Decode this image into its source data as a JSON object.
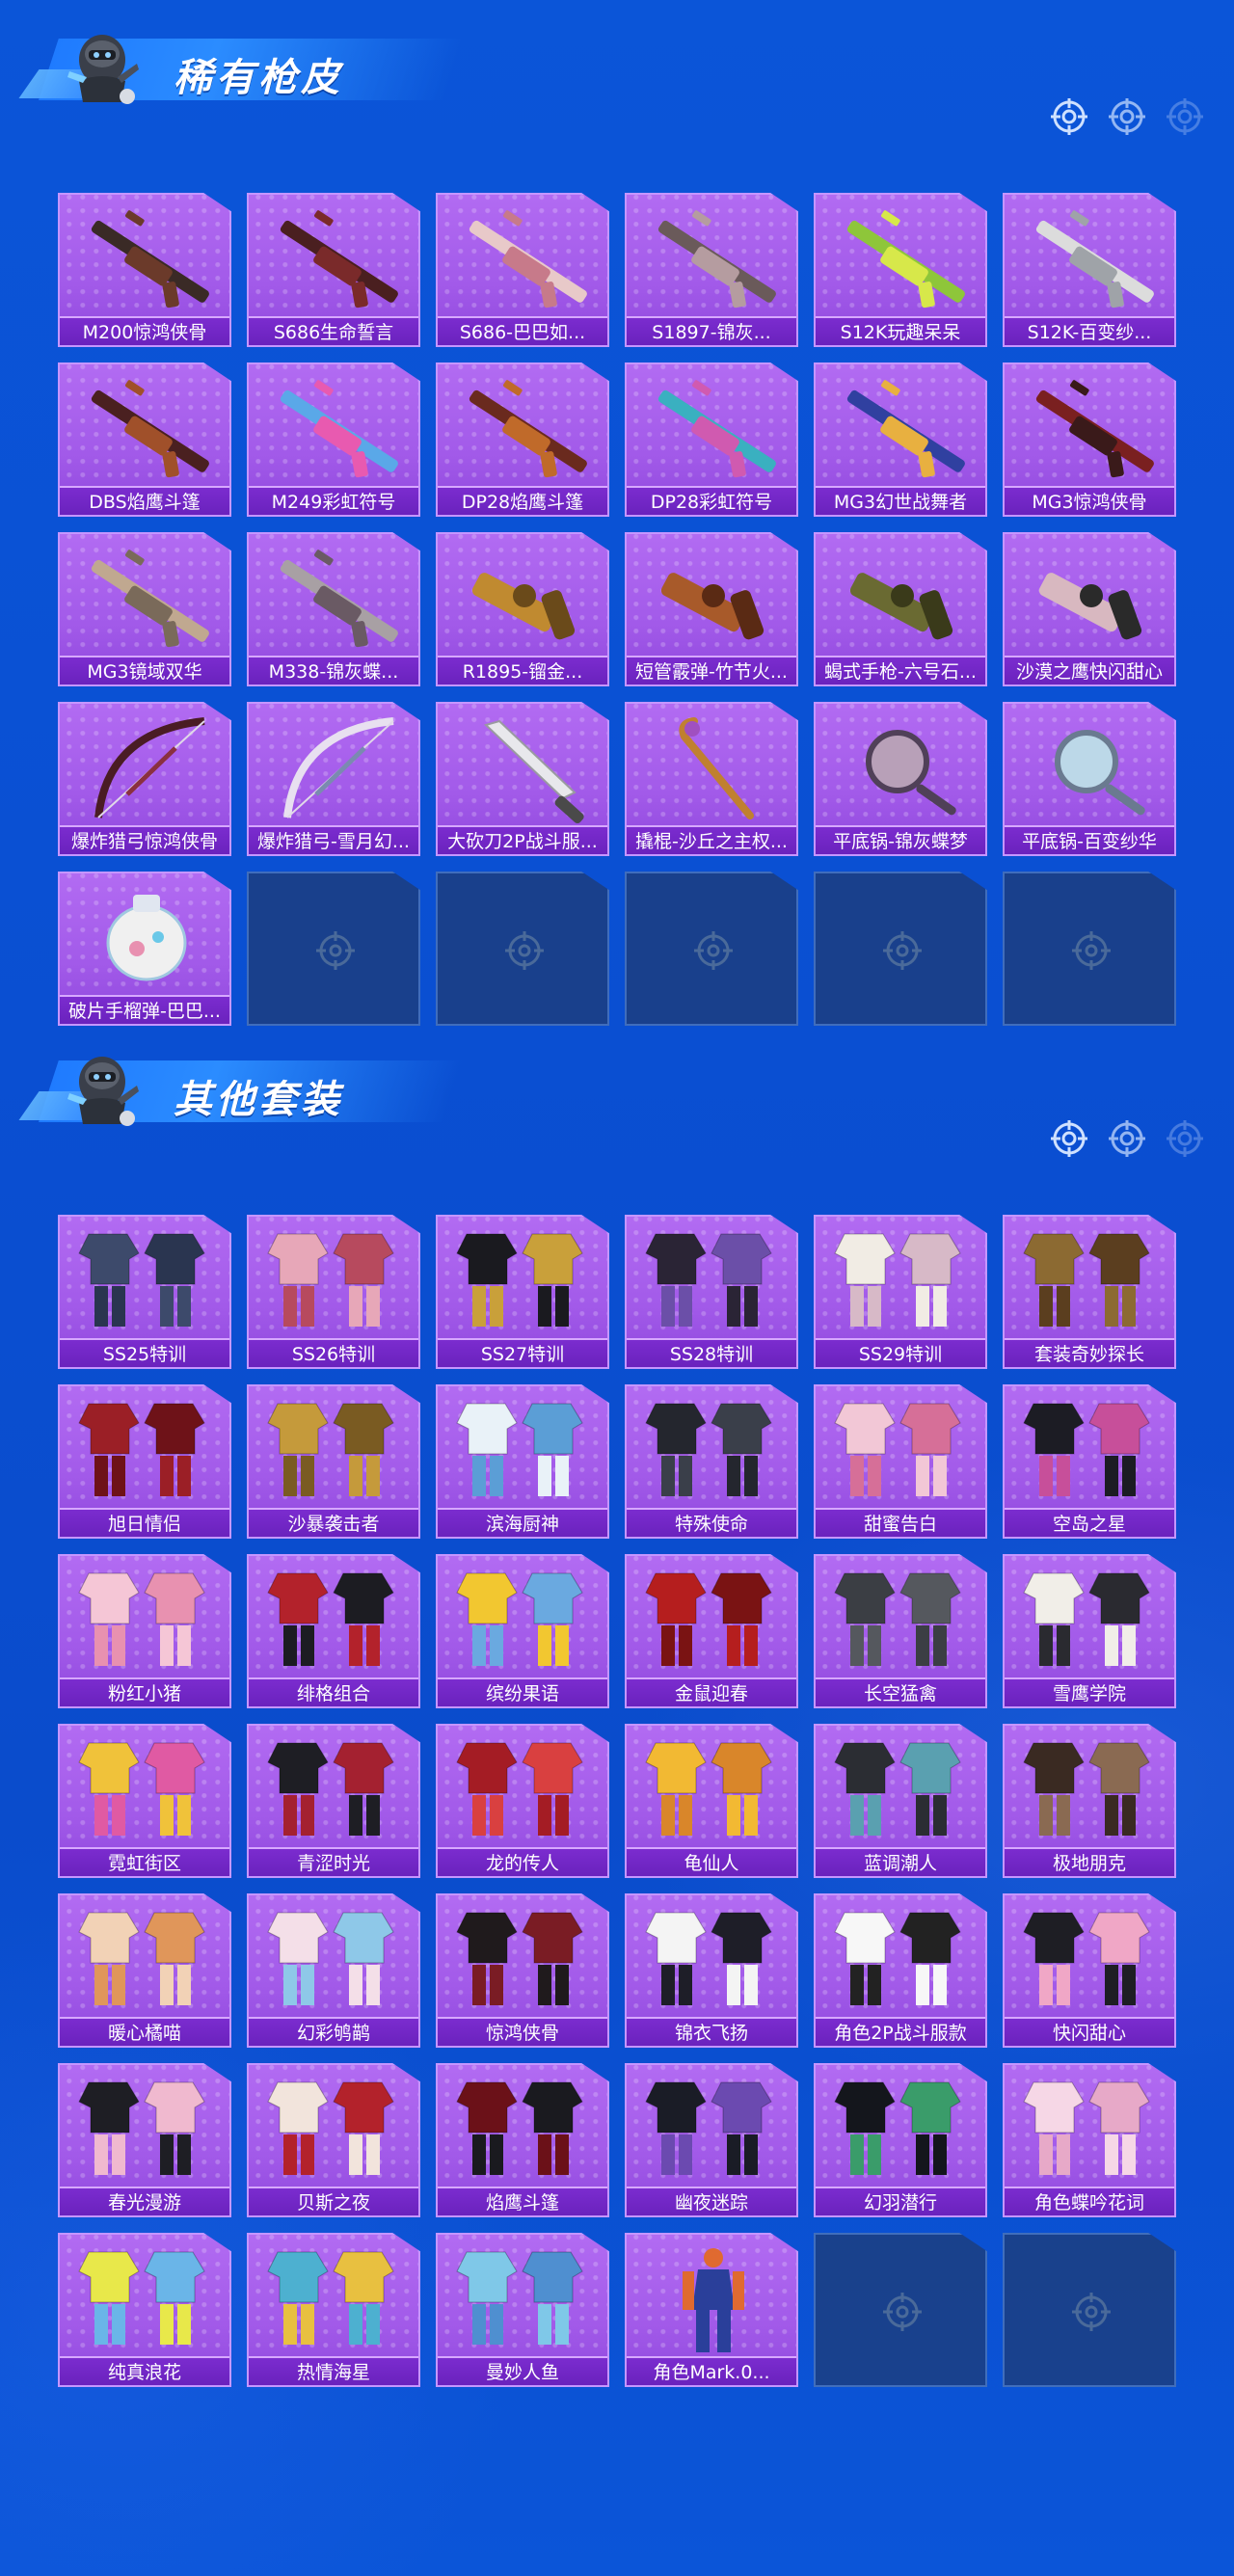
{
  "sections": [
    {
      "title": "稀有枪皮",
      "icon": "mascot-icon",
      "items": [
        {
          "label": "M200惊鸿侠骨",
          "icon": "sniper-rifle-icon"
        },
        {
          "label": "S686生命誓言",
          "icon": "shotgun-icon"
        },
        {
          "label": "S686-巴巴如...",
          "icon": "shotgun-icon"
        },
        {
          "label": "S1897-锦灰...",
          "icon": "shotgun-icon"
        },
        {
          "label": "S12K玩趣呆呆",
          "icon": "shotgun-icon"
        },
        {
          "label": "S12K-百变纱...",
          "icon": "shotgun-icon"
        },
        {
          "label": "DBS焰鹰斗篷",
          "icon": "shotgun-icon"
        },
        {
          "label": "M249彩虹符号",
          "icon": "machine-gun-icon"
        },
        {
          "label": "DP28焰鹰斗篷",
          "icon": "machine-gun-icon"
        },
        {
          "label": "DP28彩虹符号",
          "icon": "machine-gun-icon"
        },
        {
          "label": "MG3幻世战舞者",
          "icon": "machine-gun-icon"
        },
        {
          "label": "MG3惊鸿侠骨",
          "icon": "machine-gun-icon"
        },
        {
          "label": "MG3镜域双华",
          "icon": "machine-gun-icon"
        },
        {
          "label": "M338-锦灰蝶...",
          "icon": "rifle-icon"
        },
        {
          "label": "R1895-镏金...",
          "icon": "revolver-icon"
        },
        {
          "label": "短管霰弹-竹节火...",
          "icon": "sawed-off-icon"
        },
        {
          "label": "蝎式手枪-六号石...",
          "icon": "pistol-icon"
        },
        {
          "label": "沙漠之鹰快闪甜心",
          "icon": "pistol-icon"
        },
        {
          "label": "爆炸猎弓惊鸿侠骨",
          "icon": "bow-icon"
        },
        {
          "label": "爆炸猎弓-雪月幻...",
          "icon": "bow-icon"
        },
        {
          "label": "大砍刀2P战斗服...",
          "icon": "machete-icon"
        },
        {
          "label": "撬棍-沙丘之主权...",
          "icon": "crowbar-icon"
        },
        {
          "label": "平底锅-锦灰蝶梦",
          "icon": "pan-icon"
        },
        {
          "label": "平底锅-百变纱华",
          "icon": "pan-icon"
        },
        {
          "label": "破片手榴弹-巴巴...",
          "icon": "grenade-icon"
        }
      ],
      "empty_slots": 5
    },
    {
      "title": "其他套装",
      "icon": "mascot-icon",
      "items": [
        {
          "label": "SS25特训",
          "icon": "outfit-icon",
          "colors": [
            "#3d4a6b",
            "#2a3550"
          ]
        },
        {
          "label": "SS26特训",
          "icon": "outfit-icon",
          "colors": [
            "#e7a7b8",
            "#b74a5e"
          ]
        },
        {
          "label": "SS27特训",
          "icon": "outfit-icon",
          "colors": [
            "#1a1a1f",
            "#c9a03a"
          ]
        },
        {
          "label": "SS28特训",
          "icon": "outfit-icon",
          "colors": [
            "#2a2435",
            "#6b4fa8"
          ]
        },
        {
          "label": "SS29特训",
          "icon": "outfit-icon",
          "colors": [
            "#f1ece4",
            "#d7b9c7"
          ]
        },
        {
          "label": "套装奇妙探长",
          "icon": "outfit-icon",
          "colors": [
            "#8c6a32",
            "#5b3e1f"
          ]
        },
        {
          "label": "旭日情侣",
          "icon": "outfit-icon",
          "colors": [
            "#9b1f26",
            "#6e1218"
          ]
        },
        {
          "label": "沙暴袭击者",
          "icon": "outfit-icon",
          "colors": [
            "#c59a3b",
            "#7a5b22"
          ]
        },
        {
          "label": "滨海厨神",
          "icon": "outfit-icon",
          "colors": [
            "#e9f2f8",
            "#5b9ed6"
          ]
        },
        {
          "label": "特殊使命",
          "icon": "outfit-icon",
          "colors": [
            "#24262e",
            "#3a3f4a"
          ]
        },
        {
          "label": "甜蜜告白",
          "icon": "outfit-icon",
          "colors": [
            "#f2c7d6",
            "#d66f98"
          ]
        },
        {
          "label": "空岛之星",
          "icon": "outfit-icon",
          "colors": [
            "#1c1c24",
            "#c74f9a"
          ]
        },
        {
          "label": "粉红小猪",
          "icon": "outfit-icon",
          "colors": [
            "#f5c6d6",
            "#e891b0"
          ]
        },
        {
          "label": "绯格组合",
          "icon": "outfit-icon",
          "colors": [
            "#b3222b",
            "#1c1c22"
          ]
        },
        {
          "label": "缤纷果语",
          "icon": "outfit-icon",
          "colors": [
            "#f2c730",
            "#6aa9e0"
          ]
        },
        {
          "label": "金鼠迎春",
          "icon": "outfit-icon",
          "colors": [
            "#b51e1e",
            "#7a1313"
          ]
        },
        {
          "label": "长空猛禽",
          "icon": "outfit-icon",
          "colors": [
            "#3b3e44",
            "#55585e"
          ]
        },
        {
          "label": "雪鹰学院",
          "icon": "outfit-icon",
          "colors": [
            "#f1eee8",
            "#2a2a30"
          ]
        },
        {
          "label": "霓虹街区",
          "icon": "outfit-icon",
          "colors": [
            "#f0c23a",
            "#e05aa3"
          ]
        },
        {
          "label": "青涩时光",
          "icon": "outfit-icon",
          "colors": [
            "#1e1e24",
            "#a42130"
          ]
        },
        {
          "label": "龙的传人",
          "icon": "outfit-icon",
          "colors": [
            "#a41c24",
            "#d94040"
          ]
        },
        {
          "label": "龟仙人",
          "icon": "outfit-icon",
          "colors": [
            "#f2b933",
            "#d9862a"
          ]
        },
        {
          "label": "蓝调潮人",
          "icon": "outfit-icon",
          "colors": [
            "#2b2d33",
            "#5aa0b0"
          ]
        },
        {
          "label": "极地朋克",
          "icon": "outfit-icon",
          "colors": [
            "#3a2a22",
            "#8a6a52"
          ]
        },
        {
          "label": "暖心橘喵",
          "icon": "outfit-icon",
          "colors": [
            "#f2d2b6",
            "#e0965a"
          ]
        },
        {
          "label": "幻彩鸲鹋",
          "icon": "outfit-icon",
          "colors": [
            "#f4dfe8",
            "#8ec8e8"
          ]
        },
        {
          "label": "惊鸿侠骨",
          "icon": "outfit-icon",
          "colors": [
            "#1f1a1c",
            "#7a1c24"
          ]
        },
        {
          "label": "锦衣飞扬",
          "icon": "outfit-icon",
          "colors": [
            "#f4f4f4",
            "#1e1e28"
          ]
        },
        {
          "label": "角色2P战斗服款",
          "icon": "outfit-icon",
          "colors": [
            "#f7f7f7",
            "#222222"
          ]
        },
        {
          "label": "快闪甜心",
          "icon": "outfit-icon",
          "colors": [
            "#1e1e24",
            "#f0a7c6"
          ]
        },
        {
          "label": "春光漫游",
          "icon": "outfit-icon",
          "colors": [
            "#1e1e24",
            "#f0b9cf"
          ]
        },
        {
          "label": "贝斯之夜",
          "icon": "outfit-icon",
          "colors": [
            "#f2e4dc",
            "#b3222b"
          ]
        },
        {
          "label": "焰鹰斗篷",
          "icon": "outfit-icon",
          "colors": [
            "#6b1118",
            "#1a1a1f"
          ]
        },
        {
          "label": "幽夜迷踪",
          "icon": "outfit-icon",
          "colors": [
            "#1a1c26",
            "#6b4ab0"
          ]
        },
        {
          "label": "幻羽潜行",
          "icon": "outfit-icon",
          "colors": [
            "#14161c",
            "#3a9c6a"
          ]
        },
        {
          "label": "角色蝶吟花词",
          "icon": "outfit-icon",
          "colors": [
            "#f6d7e6",
            "#e7a9c8"
          ]
        },
        {
          "label": "纯真浪花",
          "icon": "outfit-icon",
          "colors": [
            "#e8e84a",
            "#6ab5e8"
          ]
        },
        {
          "label": "热情海星",
          "icon": "outfit-icon",
          "colors": [
            "#4db0d0",
            "#e8c040"
          ]
        },
        {
          "label": "曼妙人鱼",
          "icon": "outfit-icon",
          "colors": [
            "#7fc8e8",
            "#4f8fd0"
          ]
        },
        {
          "label": "角色Mark.0...",
          "icon": "character-icon",
          "colors": [
            "#2a3f9a",
            "#e06a30"
          ]
        }
      ],
      "empty_slots": 2
    }
  ],
  "colors": {
    "background": "#0a4fd2",
    "card": "#a25ae9",
    "label_bar": "#6a22bd",
    "empty_slot": "#1e3c78"
  }
}
